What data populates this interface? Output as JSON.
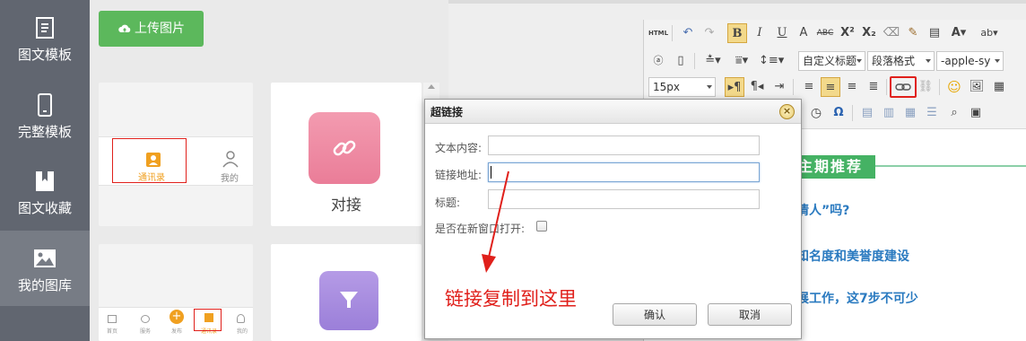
{
  "sidenav": {
    "items": [
      {
        "label": "图文模板",
        "icon": "document-icon"
      },
      {
        "label": "完整模板",
        "icon": "phone-icon"
      },
      {
        "label": "图文收藏",
        "icon": "bookmark-icon"
      },
      {
        "label": "我的图库",
        "icon": "image-icon",
        "active": true
      }
    ]
  },
  "gallery": {
    "upload_label": "上传图片",
    "cards": [
      {
        "tab_contacts": "通讯录",
        "tab_mine": "我的"
      },
      {
        "caption": "对接"
      },
      {
        "tabs": [
          "首页",
          "服务",
          "发布",
          "通讯录",
          "我的"
        ]
      },
      {
        "caption": ""
      }
    ]
  },
  "editor": {
    "toolbar": {
      "font_size": "15px",
      "custom_title": "自定义标题",
      "paragraph_format": "段落格式",
      "font_family": "-apple-sy",
      "html_label": "HTML"
    },
    "article": {
      "section_badge": "主期推荐",
      "links": [
        "情人”吗?",
        "知名度和美誉度建设",
        "展工作，这7步不可少"
      ]
    }
  },
  "dialog": {
    "title": "超链接",
    "fields": {
      "text_label": "文本内容:",
      "text_value": "",
      "url_label": "链接地址:",
      "url_value": "",
      "title_label": "标题:",
      "title_value": "",
      "newwin_label": "是否在新窗口打开:"
    },
    "confirm_label": "确认",
    "cancel_label": "取消",
    "annotation": "链接复制到这里"
  },
  "colors": {
    "sidenav_bg": "#616670",
    "upload_green": "#5cb85c",
    "highlight_red": "#e0201b",
    "section_green": "#45b264",
    "link_blue": "#2a7ac0"
  }
}
